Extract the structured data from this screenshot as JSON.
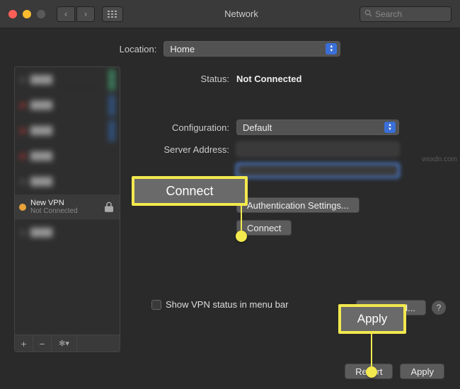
{
  "window": {
    "title": "Network",
    "search_placeholder": "Search"
  },
  "location": {
    "label": "Location:",
    "value": "Home"
  },
  "sidebar": {
    "vpn": {
      "name": "New VPN",
      "status": "Not Connected"
    },
    "footer": {
      "add": "+",
      "remove": "−",
      "gear": "✻▾"
    }
  },
  "detail": {
    "status_label": "Status:",
    "status_value": "Not Connected",
    "config_label": "Configuration:",
    "config_value": "Default",
    "server_label": "Server Address:",
    "auth_button": "Authentication Settings...",
    "connect_button": "Connect",
    "show_menu_label": "Show VPN status in menu bar",
    "advanced_button": "Advanced...",
    "help": "?"
  },
  "callouts": {
    "connect": "Connect",
    "apply": "Apply"
  },
  "footer": {
    "revert": "Revert",
    "apply": "Apply"
  },
  "watermark": "wsxdn.com"
}
